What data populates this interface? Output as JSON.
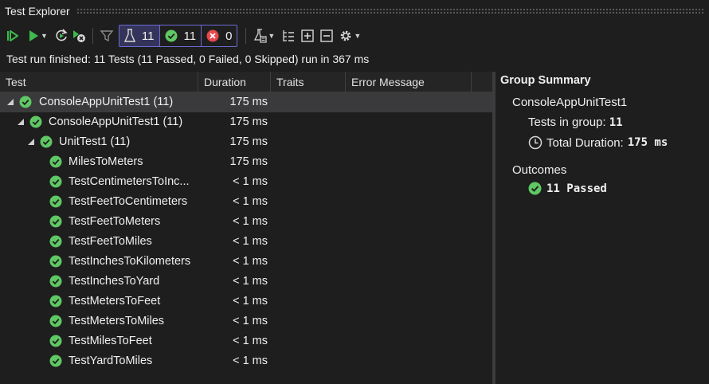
{
  "window": {
    "title": "Test Explorer"
  },
  "toolbar": {
    "filter_total_count": "11",
    "filter_passed_count": "11",
    "filter_failed_count": "0"
  },
  "status": {
    "text": "Test run finished: 11 Tests (11 Passed, 0 Failed, 0 Skipped) run in 367 ms"
  },
  "columns": {
    "test": "Test",
    "duration": "Duration",
    "traits": "Traits",
    "error": "Error Message"
  },
  "tree": [
    {
      "name": "ConsoleAppUnitTest1  (11)",
      "duration": "175 ms",
      "level": 0,
      "expandable": true,
      "selected": true
    },
    {
      "name": "ConsoleAppUnitTest1  (11)",
      "duration": "175 ms",
      "level": 1,
      "expandable": true
    },
    {
      "name": "UnitTest1  (11)",
      "duration": "175 ms",
      "level": 2,
      "expandable": true
    },
    {
      "name": "MilesToMeters",
      "duration": "175 ms",
      "level": 3
    },
    {
      "name": "TestCentimetersToInc...",
      "duration": "< 1 ms",
      "level": 3
    },
    {
      "name": "TestFeetToCentimeters",
      "duration": "< 1 ms",
      "level": 3
    },
    {
      "name": "TestFeetToMeters",
      "duration": "< 1 ms",
      "level": 3
    },
    {
      "name": "TestFeetToMiles",
      "duration": "< 1 ms",
      "level": 3
    },
    {
      "name": "TestInchesToKilometers",
      "duration": "< 1 ms",
      "level": 3
    },
    {
      "name": "TestInchesToYard",
      "duration": "< 1 ms",
      "level": 3
    },
    {
      "name": "TestMetersToFeet",
      "duration": "< 1 ms",
      "level": 3
    },
    {
      "name": "TestMetersToMiles",
      "duration": "< 1 ms",
      "level": 3
    },
    {
      "name": "TestMilesToFeet",
      "duration": "< 1 ms",
      "level": 3
    },
    {
      "name": "TestYardToMiles",
      "duration": "< 1 ms",
      "level": 3
    }
  ],
  "summary": {
    "header": "Group Summary",
    "group_name": "ConsoleAppUnitTest1",
    "tests_in_group_label": "Tests in group:",
    "tests_in_group_value": "11",
    "total_duration_label": "Total Duration:",
    "total_duration_value": "175 ms",
    "outcomes_label": "Outcomes",
    "outcome_passed": "11 Passed"
  },
  "colors": {
    "pass": "#5fc864",
    "fail": "#e5484d",
    "filter_border": "#6b6bd6",
    "run_accent": "#3fb94d"
  },
  "icons": [
    "run-all-icon",
    "run-icon",
    "repeat-run-icon",
    "cancel-run-icon",
    "filter-icon",
    "flask-icon",
    "passed-icon",
    "failed-icon",
    "playlist-icon",
    "hierarchy-icon",
    "expand-all-icon",
    "collapse-all-icon",
    "settings-icon",
    "clock-icon"
  ]
}
